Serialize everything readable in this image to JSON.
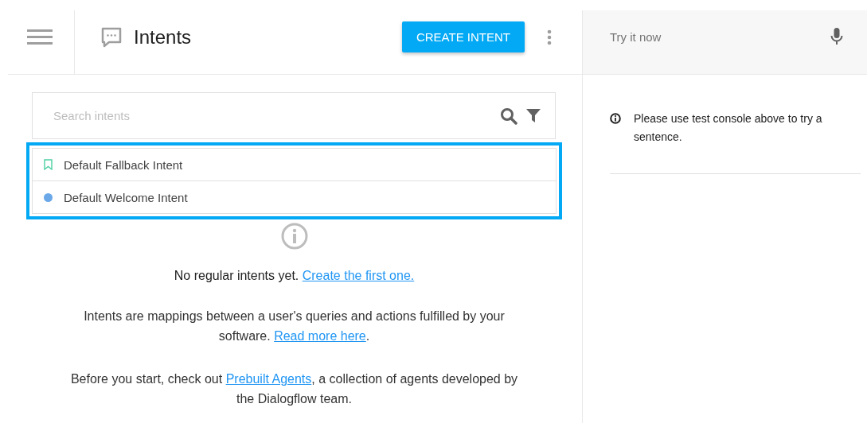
{
  "header": {
    "title": "Intents",
    "create_button": "CREATE INTENT"
  },
  "search": {
    "placeholder": "Search intents"
  },
  "intent_list": {
    "highlighted": true,
    "items": [
      {
        "kind": "fallback",
        "label": "Default Fallback Intent"
      },
      {
        "kind": "welcome",
        "label": "Default Welcome Intent"
      }
    ]
  },
  "empty_state": {
    "headline": [
      {
        "text": "No regular intents yet. "
      },
      {
        "link": "Create the first one."
      }
    ],
    "paragraphs": [
      [
        {
          "text": "Intents are mappings between a user's queries and actions fulfilled by your software. "
        },
        {
          "link": "Read more here"
        },
        {
          "text": "."
        }
      ],
      [
        {
          "text": "Before you start, check out "
        },
        {
          "link": "Prebuilt Agents"
        },
        {
          "text": ", a collection of agents developed by the Dialogflow team."
        }
      ]
    ]
  },
  "test_console": {
    "placeholder": "Try it now",
    "note": "Please use test console above to try a sentence."
  }
}
